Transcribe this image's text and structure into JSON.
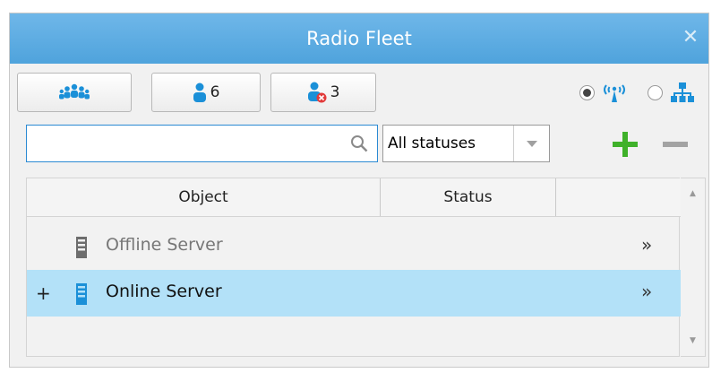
{
  "window": {
    "title": "Radio Fleet",
    "close_glyph": "✕"
  },
  "toolbar": {
    "groups_icon": "group-icon",
    "online_users_count": "6",
    "offline_users_count": "3",
    "view_mode": "radio-tower",
    "view_modes": [
      "radio-tower",
      "hierarchy"
    ]
  },
  "filter": {
    "search_value": "",
    "search_placeholder": "",
    "status_selected": "All statuses"
  },
  "table": {
    "columns": [
      "Object",
      "Status",
      ""
    ],
    "rows": [
      {
        "expander": "",
        "name": "Offline Server",
        "status": "",
        "more": "»",
        "selected": false,
        "online": false
      },
      {
        "expander": "+",
        "name": "Online Server",
        "status": "",
        "more": "»",
        "selected": true,
        "online": true
      }
    ]
  },
  "colors": {
    "titlebar": "#5aaee2",
    "accent_blue": "#1b90d8",
    "selected_row": "#b3e1f8",
    "add_green": "#3fb12a",
    "remove_gray": "#9a9a9a",
    "offline_text": "#777777"
  }
}
